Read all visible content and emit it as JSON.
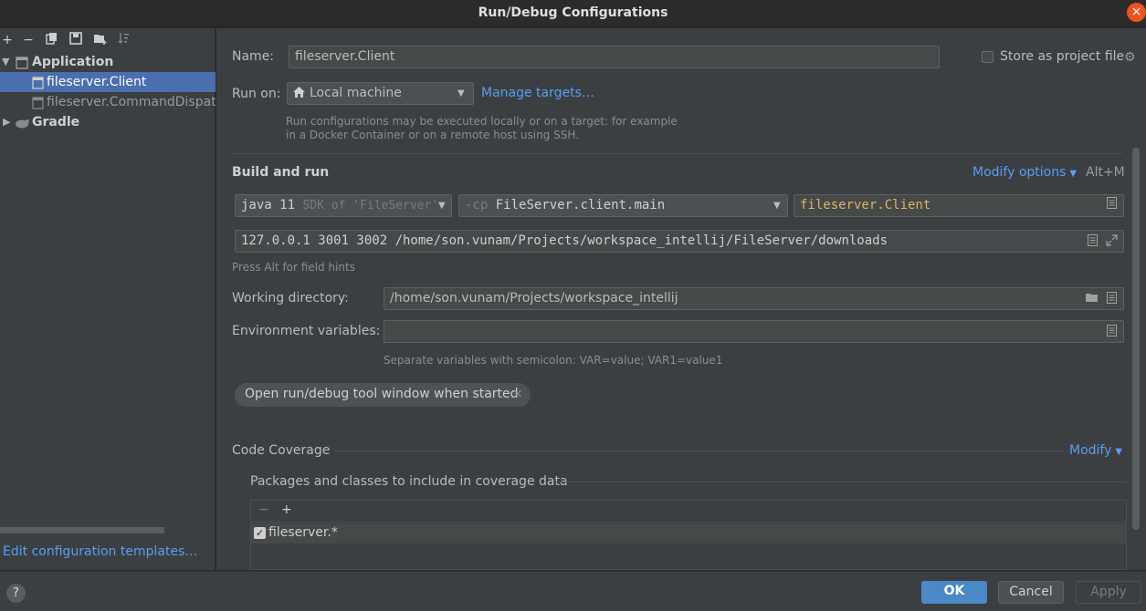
{
  "window": {
    "title": "Run/Debug Configurations",
    "close_glyph": "×"
  },
  "toolbar": {
    "icons": [
      "add-icon",
      "remove-icon",
      "copy-icon",
      "save-icon",
      "new-folder-icon",
      "sort-icon"
    ]
  },
  "tree": {
    "application_label": "Application",
    "items": [
      "fileserver.Client",
      "fileserver.CommandDispatcher"
    ],
    "gradle_label": "Gradle"
  },
  "edit_templates_link": "Edit configuration templates…",
  "form": {
    "name_label": "Name:",
    "name_value": "fileserver.Client",
    "store_label": "Store as project file",
    "run_on_label": "Run on:",
    "run_on_value": "Local machine",
    "manage_targets": "Manage targets…",
    "run_on_hint_1": "Run configurations may be executed locally or on a target: for example",
    "run_on_hint_2": "in a Docker Container or on a remote host using SSH.",
    "build_run_title": "Build and run",
    "modify_options": "Modify options",
    "modify_shortcut": "Alt+M",
    "jdk_bold": "java 11",
    "jdk_dim": "SDK of 'FileServer'",
    "cp_prefix": "-cp",
    "cp_value": "FileServer.client.main",
    "main_class": "fileserver.Client",
    "program_args": "127.0.0.1 3001 3002 /home/son.vunam/Projects/workspace_intellij/FileServer/downloads",
    "field_hints": "Press Alt for field hints",
    "working_dir_label": "Working directory:",
    "working_dir_value": "/home/son.vunam/Projects/workspace_intellij",
    "env_label": "Environment variables:",
    "env_value": "",
    "env_hint": "Separate variables with semicolon: VAR=value; VAR1=value1",
    "chip_label": "Open run/debug tool window when started",
    "chip_close": "×",
    "coverage_title": "Code Coverage",
    "coverage_modify": "Modify",
    "packages_title": "Packages and classes to include in coverage data",
    "package_items": [
      {
        "label": "fileserver.*",
        "checked": true
      }
    ]
  },
  "buttons": {
    "help": "?",
    "ok": "OK",
    "cancel": "Cancel",
    "apply": "Apply"
  },
  "colors": {
    "accent": "#589df6",
    "selection": "#4b6eaf",
    "primary_button": "#365880",
    "close": "#e95420"
  }
}
